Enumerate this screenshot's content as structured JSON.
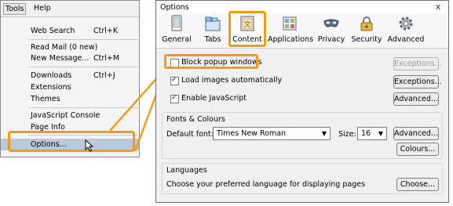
{
  "menu": {
    "tools_label": "Tools",
    "help_label": "Help",
    "items": [
      {
        "label": "Web Search",
        "shortcut": "Ctrl+K"
      },
      {
        "label": "Read Mail (0 new)",
        "shortcut": ""
      },
      {
        "label": "New Message...",
        "shortcut": "Ctrl+M"
      },
      {
        "label": "Downloads",
        "shortcut": "Ctrl+J"
      },
      {
        "label": "Extensions",
        "shortcut": ""
      },
      {
        "label": "Themes",
        "shortcut": ""
      },
      {
        "label": "JavaScript Console",
        "shortcut": ""
      },
      {
        "label": "Page Info",
        "shortcut": ""
      },
      {
        "label": "Options...",
        "shortcut": ""
      }
    ]
  },
  "window": {
    "title": "Options",
    "close": "x",
    "tabs": [
      {
        "label": "General",
        "icon": "general-icon"
      },
      {
        "label": "Tabs",
        "icon": "tabs-icon"
      },
      {
        "label": "Content",
        "icon": "content-icon"
      },
      {
        "label": "Applications",
        "icon": "applications-icon"
      },
      {
        "label": "Privacy",
        "icon": "privacy-mask-icon"
      },
      {
        "label": "Security",
        "icon": "security-lock-icon"
      },
      {
        "label": "Advanced",
        "icon": "advanced-gear-icon"
      }
    ],
    "selected_tab": "Content",
    "content": {
      "block_popups": {
        "label": "Block popup windows",
        "checked": false,
        "button": "Exceptions..."
      },
      "load_images": {
        "label": "Load images automatically",
        "checked": true,
        "button": "Exceptions..."
      },
      "enable_js": {
        "label": "Enable JavaScript",
        "checked": true,
        "button": "Advanced..."
      },
      "fonts": {
        "title": "Fonts & Colours",
        "default_font_label": "Default font:",
        "default_font": "Times New Roman",
        "size_label": "Size:",
        "size": "16",
        "advanced_button": "Advanced...",
        "colours_button": "Colours..."
      },
      "languages": {
        "title": "Languages",
        "description": "Choose your preferred language for displaying pages",
        "choose_button": "Choose..."
      }
    }
  },
  "colors": {
    "highlight": "#f39b18",
    "menu_selected": "#b8c9dc"
  }
}
